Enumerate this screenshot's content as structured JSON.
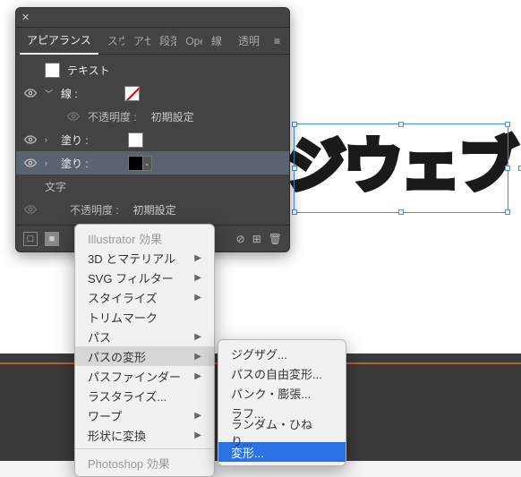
{
  "canvas": {
    "artwork_text": "ジウェブ"
  },
  "panel": {
    "title": "アピアランス",
    "tabs": [
      "スウ",
      "アセ",
      "段落",
      "Ope",
      "線",
      "透明"
    ],
    "rows": {
      "text": "テキスト",
      "stroke": "線 :",
      "fill": "塗り :",
      "fill2": "塗り :",
      "char": "文字",
      "opacity_label": "不透明度 :",
      "opacity_value": "初期設定"
    }
  },
  "menu_a": {
    "header": "Illustrator 効果",
    "items": [
      {
        "label": "3D とマテリアル",
        "sub": true
      },
      {
        "label": "SVG フィルター",
        "sub": true
      },
      {
        "label": "スタイライズ",
        "sub": true
      },
      {
        "label": "トリムマーク",
        "sub": false
      },
      {
        "label": "パス",
        "sub": true
      },
      {
        "label": "パスの変形",
        "sub": true,
        "selected": true
      },
      {
        "label": "パスファインダー",
        "sub": true
      },
      {
        "label": "ラスタライズ...",
        "sub": false
      },
      {
        "label": "ワープ",
        "sub": true
      },
      {
        "label": "形状に変換",
        "sub": true
      }
    ],
    "footer_header": "Photoshop 効果"
  },
  "menu_b": {
    "items": [
      {
        "label": "ジグザグ..."
      },
      {
        "label": "パスの自由変形..."
      },
      {
        "label": "パンク・膨張..."
      },
      {
        "label": "ラフ..."
      },
      {
        "label": "ランダム・ひねり..."
      },
      {
        "label": "変形...",
        "highlight": true
      }
    ]
  }
}
